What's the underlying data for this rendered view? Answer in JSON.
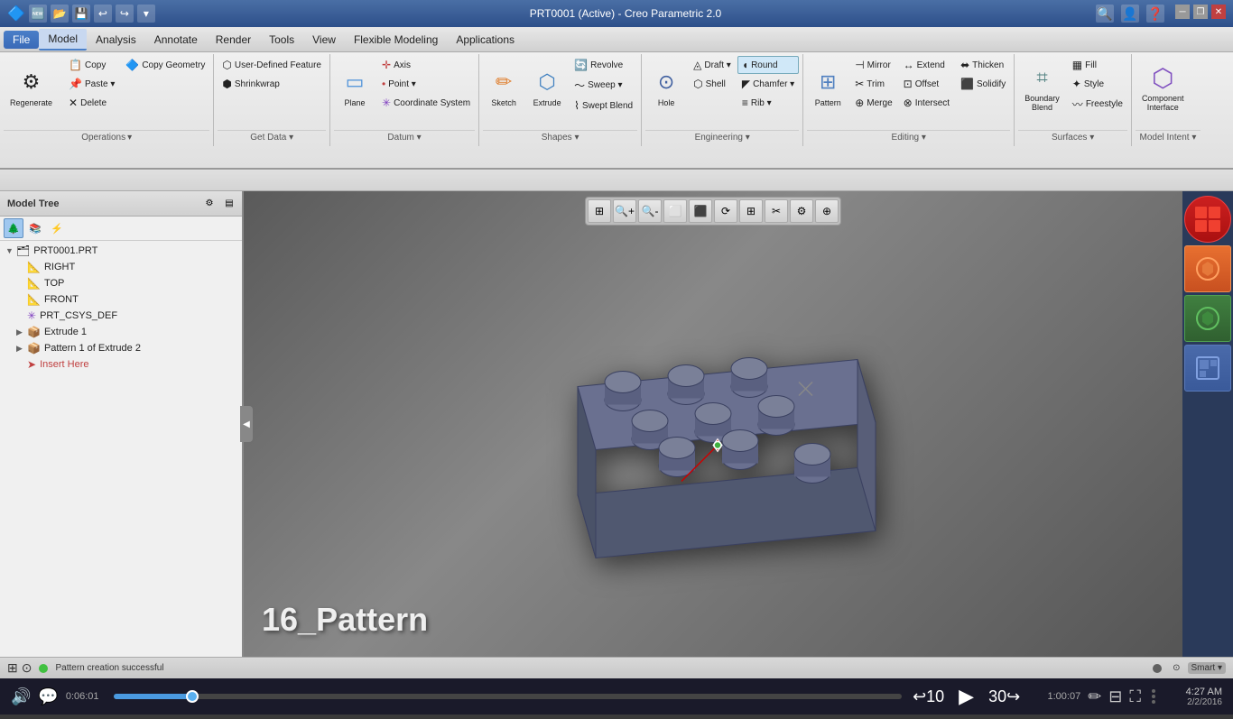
{
  "titlebar": {
    "title": "PRT0001 (Active) - Creo Parametric 2.0",
    "logo": "⬛"
  },
  "menubar": {
    "items": [
      {
        "id": "file",
        "label": "File"
      },
      {
        "id": "model",
        "label": "Model",
        "active": true
      },
      {
        "id": "analysis",
        "label": "Analysis"
      },
      {
        "id": "annotate",
        "label": "Annotate"
      },
      {
        "id": "render",
        "label": "Render"
      },
      {
        "id": "tools",
        "label": "Tools"
      },
      {
        "id": "view",
        "label": "View"
      },
      {
        "id": "flexible-modeling",
        "label": "Flexible Modeling"
      },
      {
        "id": "applications",
        "label": "Applications"
      }
    ]
  },
  "ribbon": {
    "operations": {
      "label": "Operations",
      "copy": "Copy",
      "paste": "Paste ▾",
      "delete": "✕ Delete",
      "regenerate": "Regenerate",
      "copy_geometry": "Copy Geometry"
    },
    "get_data": {
      "label": "Get Data ▾",
      "user_defined_feature": "User-Defined Feature",
      "shrinkwrap": "Shrinkwrap"
    },
    "datum": {
      "label": "Datum ▾",
      "plane": "Plane",
      "axis": "Axis",
      "point": "Point ▾",
      "coordinate_system": "Coordinate System"
    },
    "shapes": {
      "label": "Shapes ▾",
      "sketch": "Sketch",
      "extrude": "Extrude",
      "revolve": "Revolve",
      "sweep": "Sweep ▾",
      "swept_blend": "Swept Blend"
    },
    "engineering": {
      "label": "Engineering ▾",
      "hole": "Hole",
      "draft": "Draft ▾",
      "shell": "Shell",
      "round": "Round",
      "chamfer": "Chamfer ▾",
      "rib": "Rib ▾"
    },
    "editing": {
      "label": "Editing ▾",
      "mirror": "Mirror",
      "trim": "Trim",
      "merge": "Merge",
      "extend": "Extend",
      "offset": "Offset",
      "intersect": "Intersect",
      "thicken": "Thicken",
      "solidify": "Solidify",
      "pattern": "Pattern"
    },
    "surfaces": {
      "label": "Surfaces ▾",
      "fill": "Fill",
      "style": "Style",
      "boundary_blend": "Boundary Blend",
      "freestyle": "Freestyle"
    },
    "model_intent": {
      "label": "Model Intent ▾",
      "component_interface": "Component Interface"
    }
  },
  "model_tree": {
    "title": "Model Tree",
    "items": [
      {
        "id": "root",
        "label": "PRT0001.PRT",
        "icon": "🗂",
        "expanded": true,
        "level": 0
      },
      {
        "id": "right",
        "label": "RIGHT",
        "icon": "📐",
        "level": 1
      },
      {
        "id": "top",
        "label": "TOP",
        "icon": "📐",
        "level": 1
      },
      {
        "id": "front",
        "label": "FRONT",
        "icon": "📐",
        "level": 1
      },
      {
        "id": "csys",
        "label": "PRT_CSYS_DEF",
        "icon": "✳",
        "level": 1
      },
      {
        "id": "extrude1",
        "label": "Extrude 1",
        "icon": "📦",
        "expandable": true,
        "level": 1
      },
      {
        "id": "pattern1",
        "label": "Pattern 1 of Extrude 2",
        "icon": "📦",
        "expandable": true,
        "level": 1
      },
      {
        "id": "insert",
        "label": "Insert Here",
        "icon": "➤",
        "level": 1,
        "color": "red"
      }
    ]
  },
  "viewport": {
    "toolbar_buttons": [
      "🔍",
      "🔎",
      "🔍-",
      "⬜",
      "⬛",
      "⟳",
      "⊞",
      "✂",
      "🔧",
      "⊕"
    ],
    "pattern_label": "16_Pattern"
  },
  "status_bar": {
    "indicator_color": "#40c040",
    "message": "Pattern creation successful",
    "smart": "Smart",
    "indicator2_color": "#666"
  },
  "video_controls": {
    "current_time": "0:06:01",
    "total_time": "1:00:07",
    "progress_percent": 10
  },
  "taskbar": {
    "clock_time": "4:27 AM",
    "clock_date": "2/2/2016"
  },
  "right_panel_buttons": [
    {
      "icon": "◀",
      "color": "default"
    },
    {
      "icon": "★",
      "color": "orange"
    },
    {
      "icon": "▶",
      "color": "green"
    },
    {
      "icon": "◆",
      "color": "default"
    }
  ]
}
